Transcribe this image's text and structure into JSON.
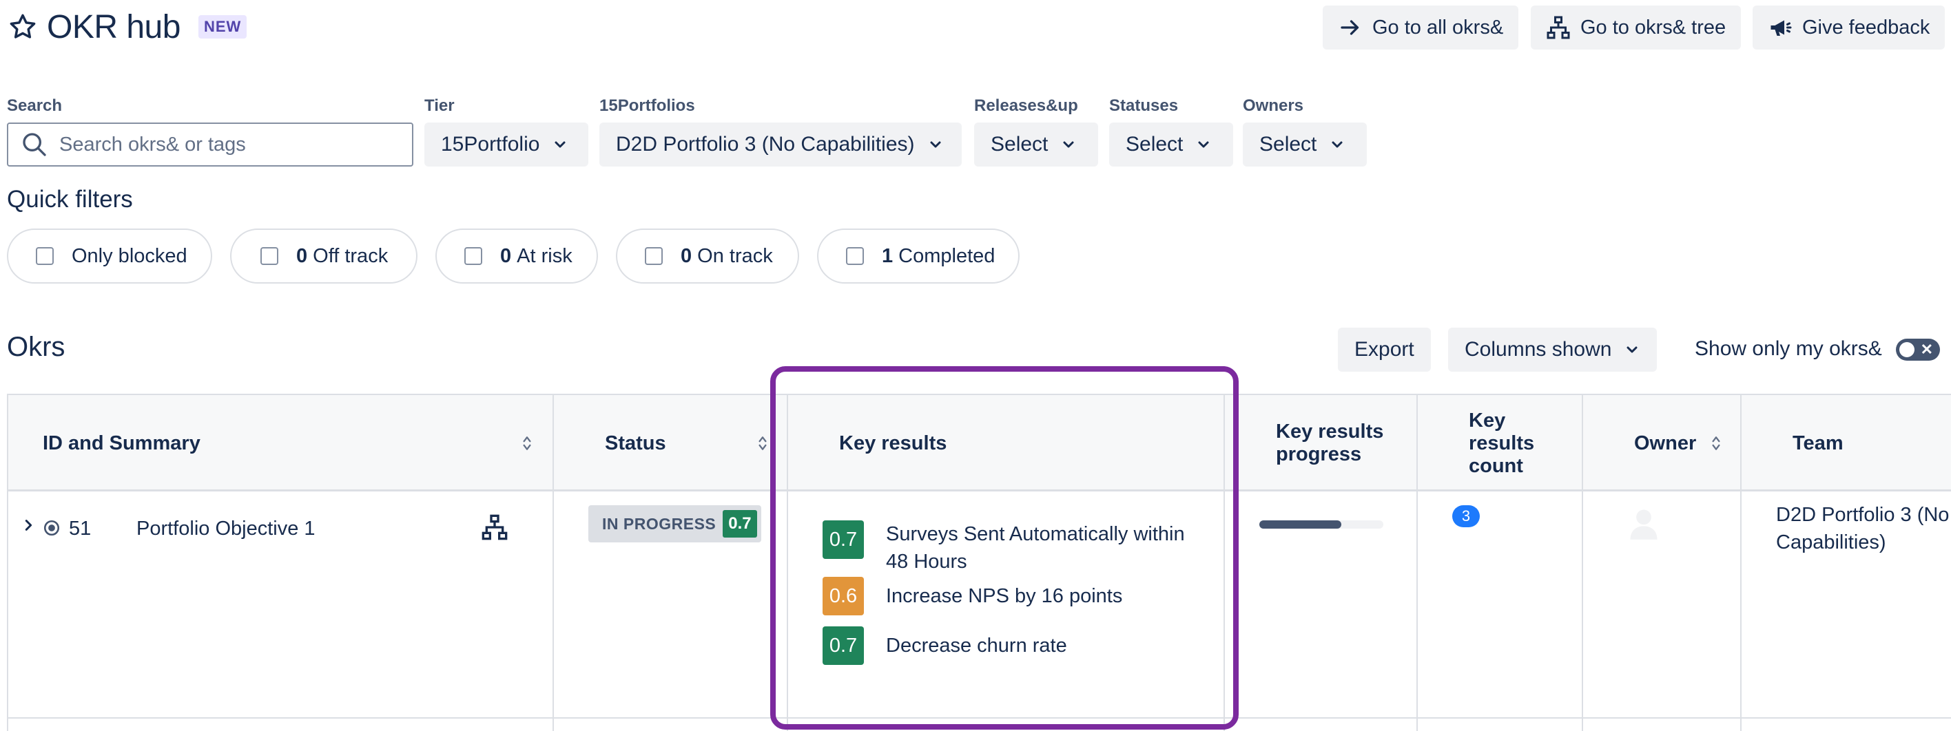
{
  "header": {
    "title": "OKR hub",
    "badge": "NEW",
    "buttons": {
      "all_okrs": "Go to all okrs&",
      "tree": "Go to okrs& tree",
      "feedback": "Give feedback"
    }
  },
  "filters": {
    "search": {
      "label": "Search",
      "placeholder": "Search okrs& or tags",
      "value": ""
    },
    "tier": {
      "label": "Tier",
      "value": "15Portfolio"
    },
    "portfolios": {
      "label": "15Portfolios",
      "value": "D2D Portfolio 3 (No Capabilities)"
    },
    "releases": {
      "label": "Releases&up",
      "value": "Select"
    },
    "statuses": {
      "label": "Statuses",
      "value": "Select"
    },
    "owners": {
      "label": "Owners",
      "value": "Select"
    }
  },
  "quick_filters": {
    "title": "Quick filters",
    "items": [
      {
        "count": "",
        "label": "Only blocked"
      },
      {
        "count": "0",
        "label": "Off track"
      },
      {
        "count": "0",
        "label": "At risk"
      },
      {
        "count": "0",
        "label": "On track"
      },
      {
        "count": "1",
        "label": "Completed"
      }
    ]
  },
  "okrs": {
    "title": "Okrs",
    "export_label": "Export",
    "columns_label": "Columns shown",
    "my_okrs_label": "Show only my okrs&",
    "my_okrs_on": false
  },
  "table": {
    "columns": {
      "id_summary": "ID and Summary",
      "status": "Status",
      "key_results": "Key results",
      "kr_progress": "Key results progress",
      "kr_count": "Key results count",
      "owner": "Owner",
      "team": "Team"
    },
    "rows": [
      {
        "id": "51",
        "summary": "Portfolio Objective 1",
        "status": "IN PROGRESS",
        "status_score": "0.7",
        "key_results": [
          {
            "score": "0.7",
            "text": "Surveys Sent Automatically within 48 Hours",
            "color": "#1f845a"
          },
          {
            "score": "0.6",
            "text": "Increase NPS by 16 points",
            "color": "#e2953a"
          },
          {
            "score": "0.7",
            "text": "Decrease churn rate",
            "color": "#1f845a"
          }
        ],
        "kr_progress": 0.66,
        "kr_count": "3",
        "team": "D2D Portfolio 3 (No Capabilities)"
      }
    ]
  },
  "colors": {
    "accent": "#1d7afc",
    "highlight_outline": "#7b2a9e",
    "score_green": "#1f845a",
    "score_orange": "#e2953a"
  }
}
